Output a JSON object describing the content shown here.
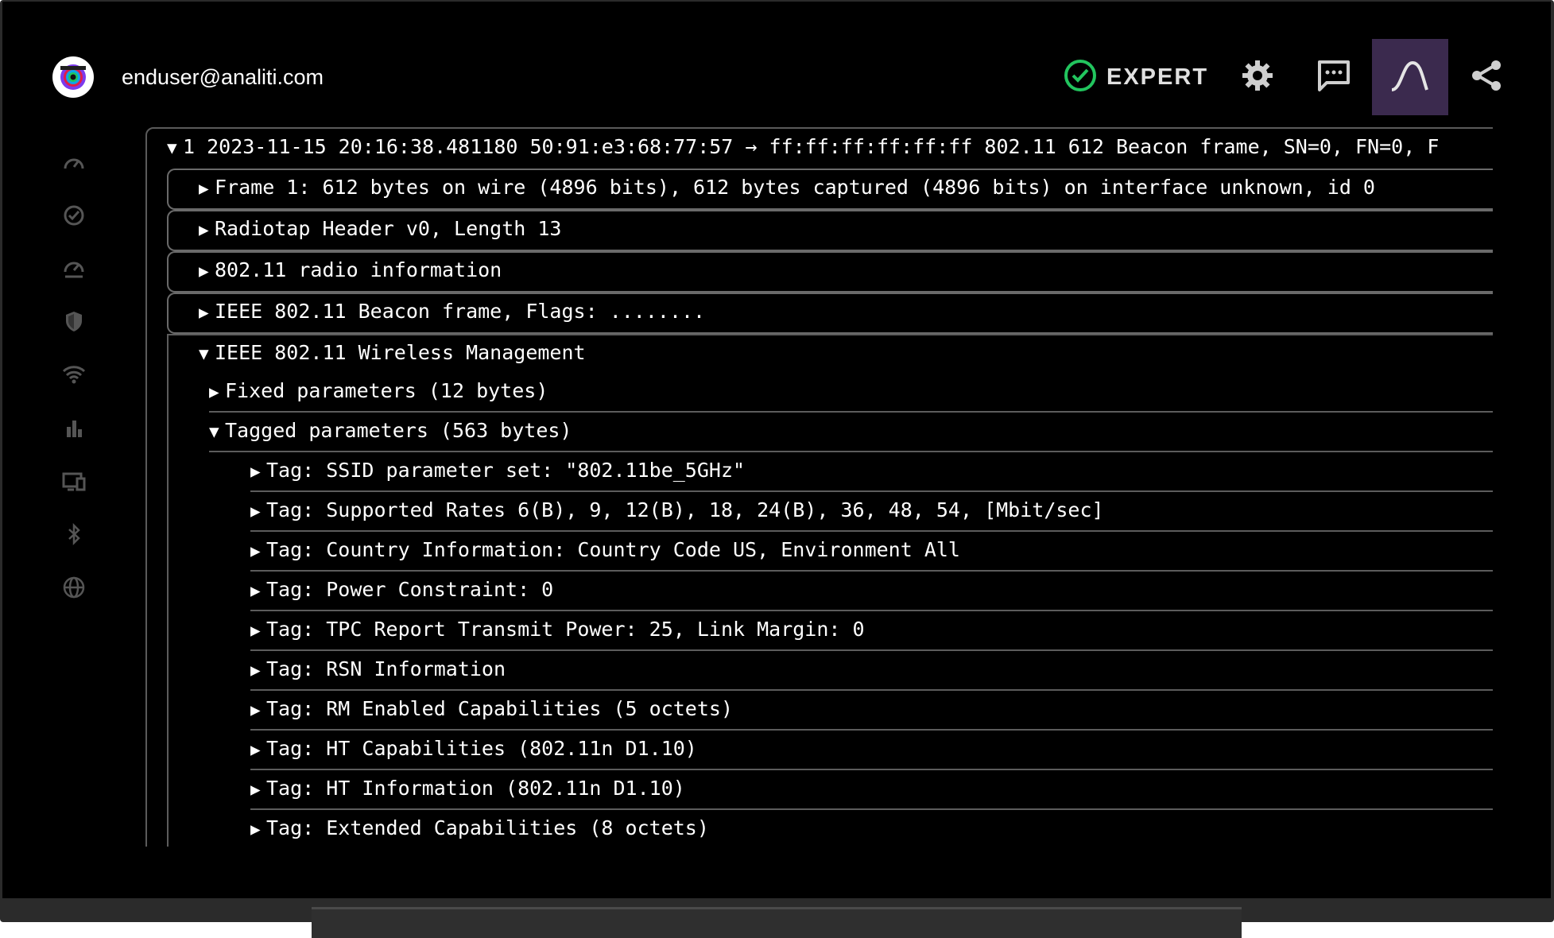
{
  "header": {
    "user_email": "enduser@analiti.com",
    "mode_label": "EXPERT",
    "mode_icon": "check-circle-icon",
    "accent_green": "#22c55e",
    "buttons": [
      "settings-icon",
      "feedback-icon",
      "signal-curve-icon",
      "share-icon"
    ],
    "active_button_color": "#3b2a4e"
  },
  "sidebar": {
    "items": [
      "speedometer-icon",
      "check-circle-icon",
      "speed-history-icon",
      "shield-icon",
      "wifi-icon",
      "bar-chart-icon",
      "devices-icon",
      "bluetooth-icon",
      "globe-icon"
    ],
    "icon_color": "#555555"
  },
  "packet": {
    "summary": "1 2023-11-15 20:16:38.481180 50:91:e3:68:77:57 → ff:ff:ff:ff:ff:ff 802.11 612 Beacon frame, SN=0, FN=0, F",
    "level1": [
      "Frame 1: 612 bytes on wire (4896 bits), 612 bytes captured (4896 bits) on interface unknown, id 0",
      "Radiotap Header v0, Length 13",
      "802.11 radio information",
      "IEEE 802.11 Beacon frame, Flags: ........",
      "IEEE 802.11 Wireless Management"
    ],
    "level2": [
      "Fixed parameters (12 bytes)",
      "Tagged parameters (563 bytes)"
    ],
    "tags": [
      "Tag: SSID parameter set: \"802.11be_5GHz\"",
      "Tag: Supported Rates 6(B), 9, 12(B), 18, 24(B), 36, 48, 54, [Mbit/sec]",
      "Tag: Country Information: Country Code US, Environment All",
      "Tag: Power Constraint: 0",
      "Tag: TPC Report Transmit Power: 25, Link Margin: 0",
      "Tag: RSN Information",
      "Tag: RM Enabled Capabilities (5 octets)",
      "Tag: HT Capabilities (802.11n D1.10)",
      "Tag: HT Information (802.11n D1.10)",
      "Tag: Extended Capabilities (8 octets)"
    ],
    "expanded_arrow": "▼",
    "collapsed_arrow": "▶"
  }
}
